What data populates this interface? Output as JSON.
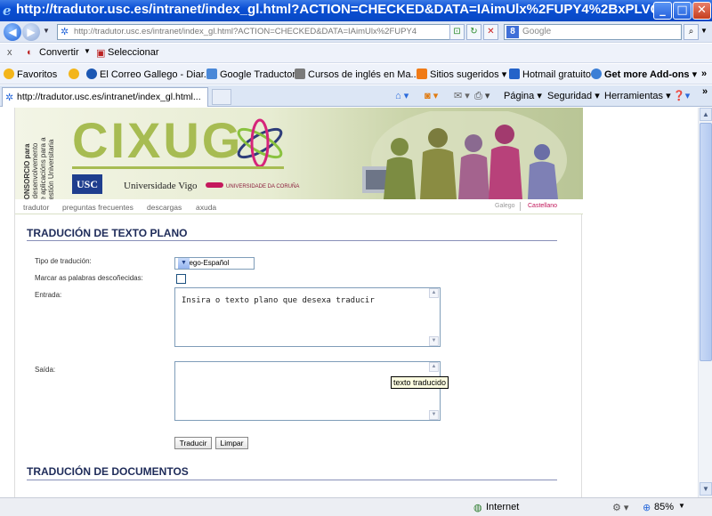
{
  "window": {
    "title": "http://tradutor.usc.es/intranet/index_gl.html?ACTION=CHECKED&DATA=IAimUlx%2FUPY4%2BxPLVQ...",
    "minimize": "_",
    "maximize": "□",
    "close": "✕"
  },
  "addressbar": {
    "url": "http://tradutor.usc.es/intranet/index_gl.html?ACTION=CHECKED&DATA=IAimUlx%2FUPY4",
    "search_placeholder": "Google"
  },
  "convert_toolbar": {
    "close": "x",
    "convert": "Convertir",
    "select": "Seleccionar"
  },
  "favorites_bar": {
    "favorites": "Favoritos",
    "items": [
      "El Correo Gallego - Diar...",
      "Google Traductor",
      "Cursos de inglés en Ma...",
      "Sitios sugeridos",
      "Hotmail gratuito",
      "Get more Add-ons"
    ],
    "more": "»"
  },
  "tabs": {
    "active_tab": "http://tradutor.usc.es/intranet/index_gl.html...",
    "commands": [
      "Página",
      "Seguridad",
      "Herramientas"
    ]
  },
  "site": {
    "vertical_text": [
      "CONSORCIO para",
      "o desenvolvemento",
      "de aplicacións para a",
      "Xestión Universitaria"
    ],
    "logo": "CIXUG",
    "usc_logo": "USC",
    "vigo": "Universidade Vigo",
    "coruna": "UNIVERSIDADE DA CORUÑA",
    "nav": [
      "tradutor",
      "preguntas frecuentes",
      "descargas",
      "axuda"
    ],
    "languages": [
      "Galego",
      "Castellano"
    ]
  },
  "form": {
    "section_title": "TRADUCIÓN DE TEXTO PLANO",
    "type_label": "Tipo de tradución:",
    "type_value": "Galego-Español",
    "mark_label": "Marcar as palabras descoñecidas:",
    "input_label": "Entrada:",
    "input_text": "Insira o texto plano que desexa traducir",
    "output_label": "Saída:",
    "output_tooltip": "texto traducido",
    "translate_button": "Traducir",
    "clear_button": "Limpar"
  },
  "docs": {
    "section_title": "TRADUCIÓN DE DOCUMENTOS"
  },
  "status": {
    "zone": "Internet",
    "zoom": "85%"
  }
}
